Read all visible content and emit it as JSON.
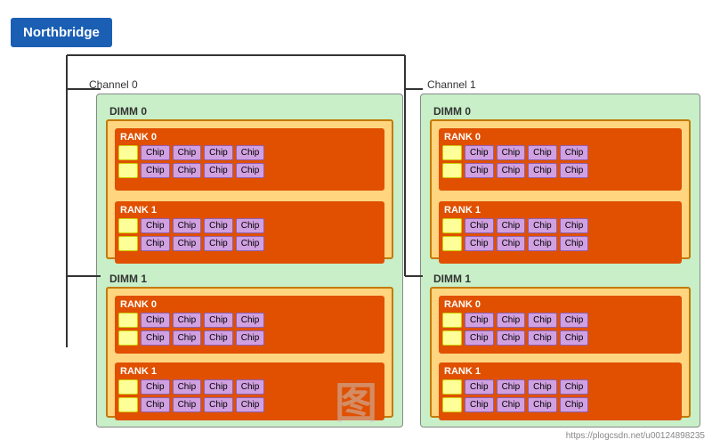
{
  "northbridge": {
    "label": "Northbridge"
  },
  "channels": [
    {
      "id": "channel0",
      "label": "Channel 0",
      "dimms": [
        {
          "id": "dimm0",
          "label": "DIMM 0",
          "ranks": [
            {
              "id": "rank0",
              "label": "RANK 0"
            },
            {
              "id": "rank1",
              "label": "RANK 1"
            }
          ]
        },
        {
          "id": "dimm1",
          "label": "DIMM 1",
          "ranks": [
            {
              "id": "rank0",
              "label": "RANK 0"
            },
            {
              "id": "rank1",
              "label": "RANK 1"
            }
          ]
        }
      ]
    },
    {
      "id": "channel1",
      "label": "Channel 1",
      "dimms": [
        {
          "id": "dimm0",
          "label": "DIMM 0",
          "ranks": [
            {
              "id": "rank0",
              "label": "RANK 0"
            },
            {
              "id": "rank1",
              "label": "RANK 1"
            }
          ]
        },
        {
          "id": "dimm1",
          "label": "DIMM 1",
          "ranks": [
            {
              "id": "rank0",
              "label": "RANK 0"
            },
            {
              "id": "rank1",
              "label": "RANK 1"
            }
          ]
        }
      ]
    }
  ],
  "chip_label": "Chip",
  "watermark": "图",
  "url": "https://plogcsdn.net/u00124898235"
}
